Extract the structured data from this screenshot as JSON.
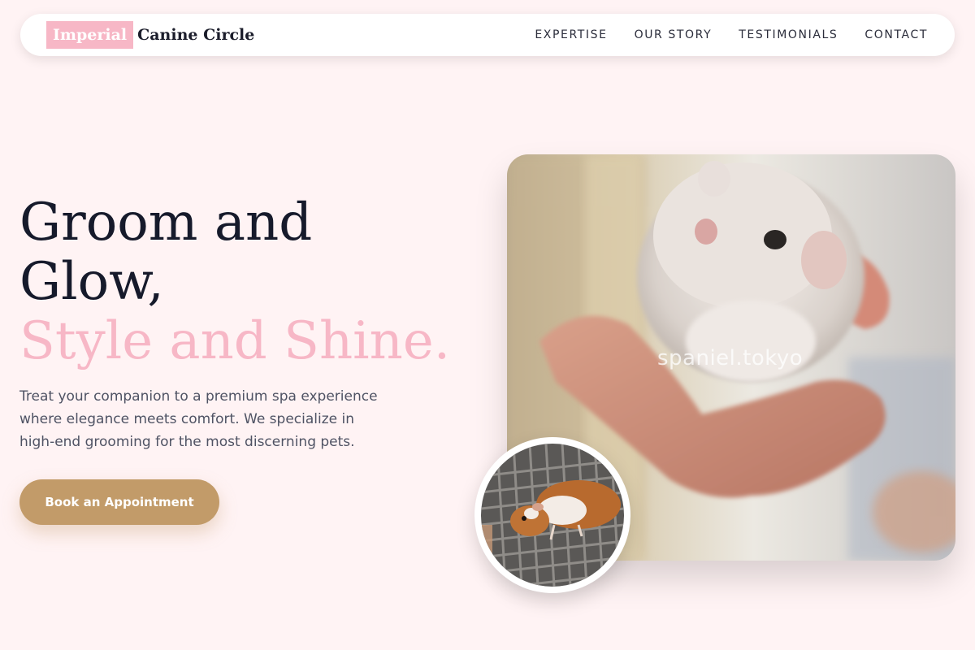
{
  "brand": {
    "badge": "Imperial",
    "name": "Canine Circle"
  },
  "nav": {
    "items": [
      {
        "label": "EXPERTISE"
      },
      {
        "label": "OUR STORY"
      },
      {
        "label": "TESTIMONIALS"
      },
      {
        "label": "CONTACT"
      }
    ]
  },
  "hero": {
    "headline_line1": "Groom and",
    "headline_line2": "Glow,",
    "headline_accent": "Style and Shine.",
    "description": "Treat your companion to a premium spa experience where elegance meets comfort. We specialize in high-end grooming for the most discerning pets.",
    "cta_label": "Book an Appointment",
    "image_watermark": "spaniel.tokyo"
  },
  "colors": {
    "background": "#fff3f4",
    "accent_pink": "#f7b7c6",
    "button_gold": "#c29b69",
    "text_dark": "#161a2b"
  },
  "icons": {
    "main_photo": "hamster-in-hand-photo",
    "circle_photo": "guinea-pig-on-cage-photo"
  }
}
